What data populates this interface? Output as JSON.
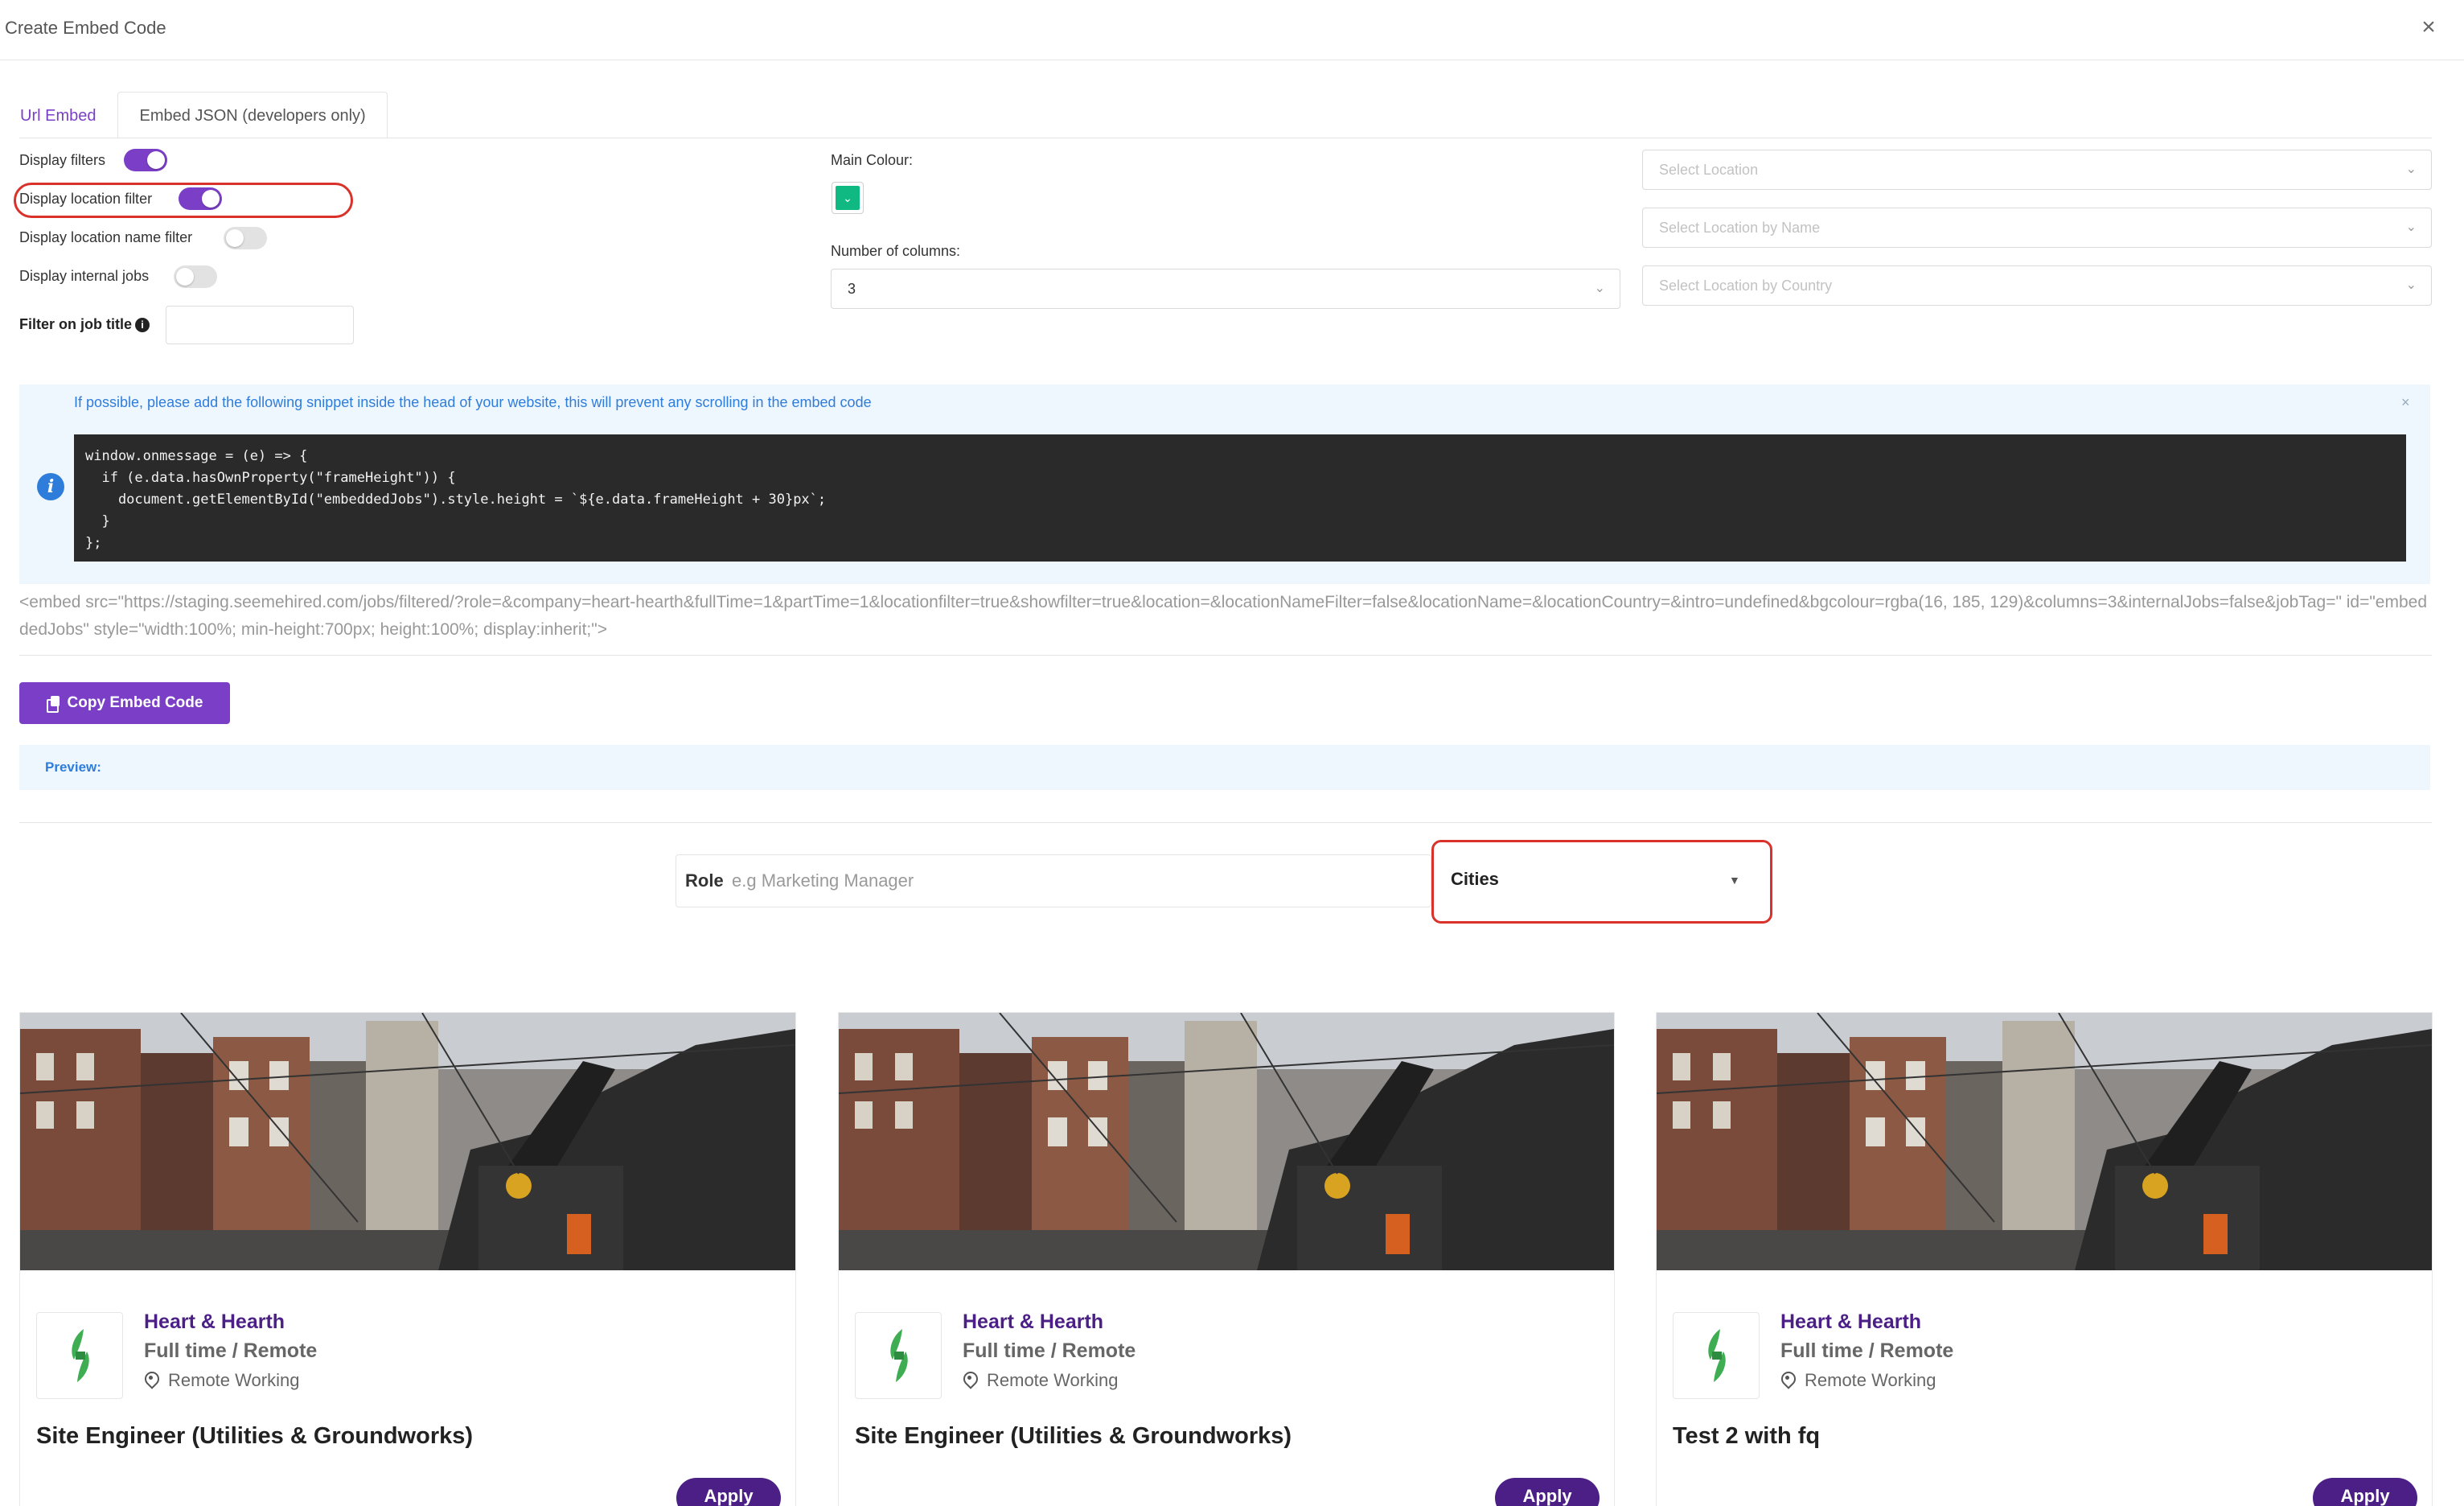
{
  "modal": {
    "title": "Create Embed Code"
  },
  "tabs": [
    {
      "label": "Url Embed",
      "active": true
    },
    {
      "label": "Embed JSON (developers only)",
      "active": false
    }
  ],
  "options": {
    "display_filters": {
      "label": "Display filters",
      "on": true
    },
    "display_location_filter": {
      "label": "Display location filter",
      "on": true
    },
    "display_location_name_filter": {
      "label": "Display location name filter",
      "on": false
    },
    "display_internal_jobs": {
      "label": "Display internal jobs",
      "on": false
    },
    "filter_job_title": {
      "label": "Filter on job title",
      "value": ""
    }
  },
  "appearance": {
    "main_colour_label": "Main Colour:",
    "main_colour": "#10b981",
    "columns_label": "Number of columns:",
    "columns_value": "3"
  },
  "location_selects": {
    "location": {
      "placeholder": "Select Location"
    },
    "by_name": {
      "placeholder": "Select Location by Name"
    },
    "by_country": {
      "placeholder": "Select Location by Country"
    }
  },
  "snippet_alert": {
    "message": "If possible, please add the following snippet inside the head of your website, this will prevent any scrolling in the embed code",
    "code_lines": [
      "window.onmessage = (e) => {",
      "  if (e.data.hasOwnProperty(\"frameHeight\")) {",
      "    document.getElementById(\"embeddedJobs\").style.height = `${e.data.frameHeight + 30}px`;",
      "  }",
      "};"
    ]
  },
  "embed_code": "<embed src=\"https://staging.seemehired.com/jobs/filtered/?role=&company=heart-hearth&fullTime=1&partTime=1&locationfilter=true&showfilter=true&location=&locationNameFilter=false&locationName=&locationCountry=&intro=undefined&bgcolour=rgba(16, 185, 129)&columns=3&internalJobs=false&jobTag=\" id=\"embeddedJobs\" style=\"width:100%; min-height:700px; height:100%; display:inherit;\">",
  "copy_button_label": "Copy Embed Code",
  "preview_label": "Preview:",
  "preview_filters": {
    "role_label": "Role",
    "role_placeholder": "e.g Marketing Manager",
    "cities_label": "Cities"
  },
  "jobs": [
    {
      "company": "Heart & Hearth",
      "type": "Full time / Remote",
      "location": "Remote Working",
      "title": "Site Engineer (Utilities & Groundworks)",
      "apply_label": "Apply"
    },
    {
      "company": "Heart & Hearth",
      "type": "Full time / Remote",
      "location": "Remote Working",
      "title": "Site Engineer (Utilities & Groundworks)",
      "apply_label": "Apply"
    },
    {
      "company": "Heart & Hearth",
      "type": "Full time / Remote",
      "location": "Remote Working",
      "title": "Test 2 with fq",
      "apply_label": "Apply"
    }
  ],
  "colors": {
    "accent": "#7b3fc7",
    "brand_dark": "#4b1f86",
    "highlight": "#d8322b",
    "info_blue": "#2f7ddb"
  }
}
